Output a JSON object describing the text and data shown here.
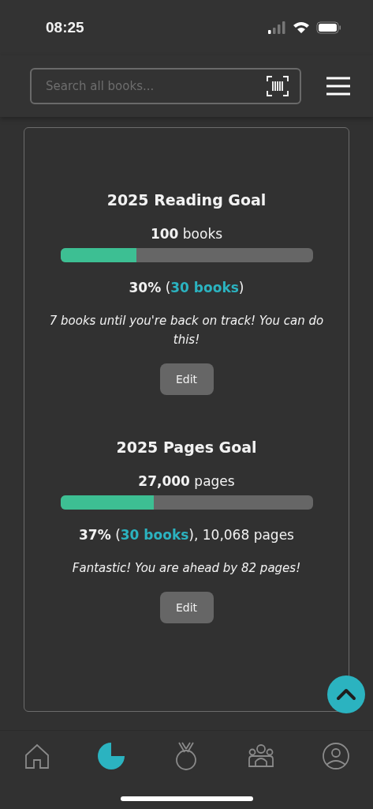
{
  "status_bar": {
    "time": "08:25"
  },
  "search": {
    "placeholder": "Search all books..."
  },
  "goals": [
    {
      "title": "2025 Reading Goal",
      "target": "**100** books",
      "level": 0.3,
      "stat_prefix": "**30%** (",
      "stat_link": "30 books",
      "stat_suffix": ")",
      "message": "7 books until you're back on track! You can do this!",
      "button": "Edit"
    },
    {
      "title": "2025 Pages Goal",
      "target": "**27,000** pages",
      "level": 0.37,
      "stat_prefix": "**37%** (",
      "stat_link": "30 books",
      "stat_suffix": "), 10,068 pages",
      "message": "Fantastic! You are ahead by 82 pages!",
      "button": "Edit"
    }
  ],
  "nav": [
    {
      "kind": "home",
      "selected": false
    },
    {
      "kind": "stats",
      "selected": true
    },
    {
      "kind": "medal",
      "selected": false
    },
    {
      "kind": "group",
      "selected": false
    },
    {
      "kind": "profile",
      "selected": false
    }
  ]
}
